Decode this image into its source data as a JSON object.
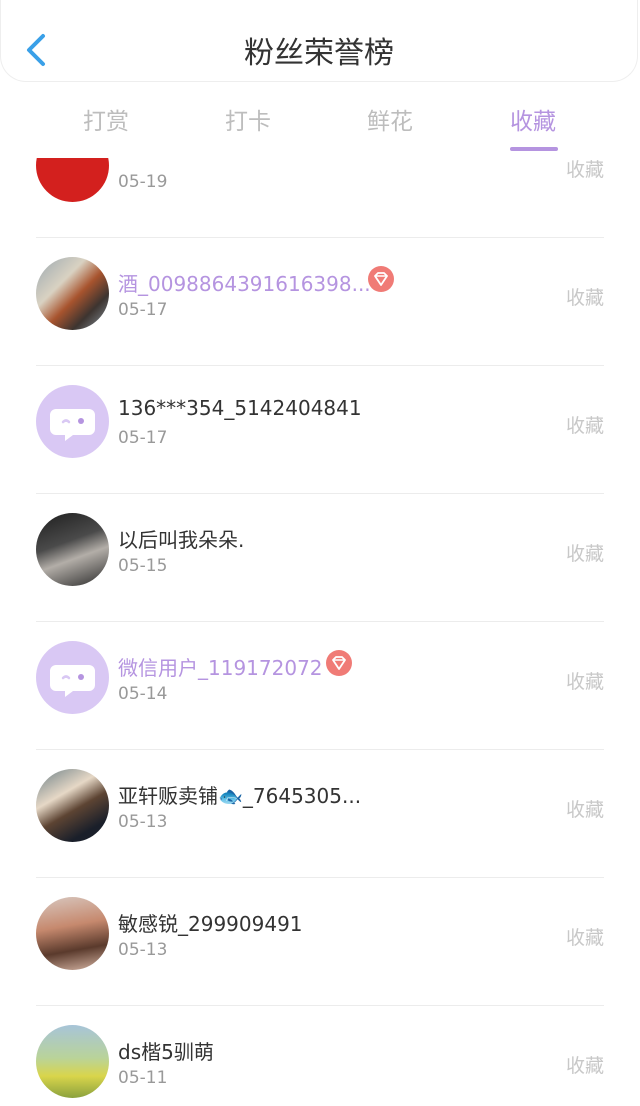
{
  "header": {
    "title": "粉丝荣誉榜"
  },
  "tabs": [
    {
      "label": "打赏",
      "active": false
    },
    {
      "label": "打卡",
      "active": false
    },
    {
      "label": "鲜花",
      "active": false
    },
    {
      "label": "收藏",
      "active": true
    }
  ],
  "colors": {
    "accent": "#b594e0",
    "badge": "#f07b76",
    "back": "#3aa0e8"
  },
  "rows": [
    {
      "name": "",
      "date": "05-19",
      "action": "收藏",
      "vip": false,
      "avatar": "red"
    },
    {
      "name": "酒_0098864391616398...",
      "date": "05-17",
      "action": "收藏",
      "vip": true,
      "avatar": "tiger"
    },
    {
      "name": "136***354_5142404841",
      "date": "05-17",
      "action": "收藏",
      "vip": false,
      "avatar": "default-chat"
    },
    {
      "name": "以后叫我朵朵.",
      "date": "05-15",
      "action": "收藏",
      "vip": false,
      "avatar": "photo"
    },
    {
      "name": "微信用户_119172072",
      "date": "05-14",
      "action": "收藏",
      "vip": true,
      "avatar": "default-chat"
    },
    {
      "name": "亚轩贩卖铺🐟_7645305...",
      "date": "05-13",
      "action": "收藏",
      "vip": false,
      "avatar": "photo"
    },
    {
      "name": "敏感锐_299909491",
      "date": "05-13",
      "action": "收藏",
      "vip": false,
      "avatar": "photo"
    },
    {
      "name": "ds楷5驯萌",
      "date": "05-11",
      "action": "收藏",
      "vip": false,
      "avatar": "photo"
    }
  ]
}
